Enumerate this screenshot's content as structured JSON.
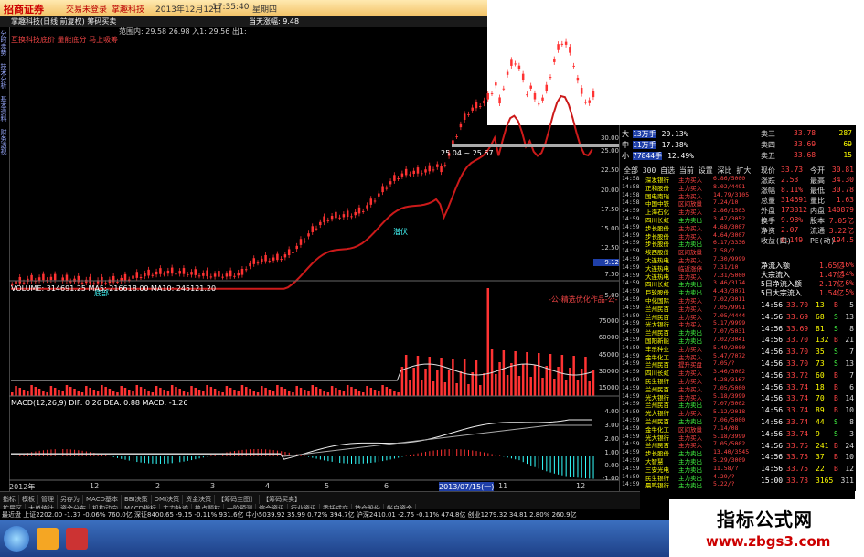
{
  "app": {
    "logo_text": "招商证券",
    "title_links": [
      "交易未登录",
      "掌趣科技",
      "2013年12月12日",
      "17:35:40",
      "星期四"
    ],
    "sub_title": "掌趣科技(日线 前复权)  筹码买卖",
    "indicator_line": "范围内: 29.58  26.98  入1: 29.56  出1:",
    "formula_line": "互换科技底价  量能底分  马上吸筹",
    "center_label": "当天涨幅: 9.48"
  },
  "left_tabs": [
    "分时走势",
    "技术分析",
    "基本资料",
    "财务透视"
  ],
  "price_axis": [
    "30.00",
    "25.00",
    "22.50",
    "20.00",
    "17.50",
    "15.00",
    "12.50",
    "10.00",
    "9.12",
    "7.50",
    "5.00"
  ],
  "volume_axis": [
    "75000",
    "60000",
    "45000",
    "30000",
    "15000"
  ],
  "macd_axis": [
    "4.00",
    "3.00",
    "2.00",
    "1.00",
    "0.00",
    "-1.00"
  ],
  "labels": {
    "volume": "VOLUME: 314691.25  MA5: 216618.00  MA10: 245121.20",
    "macd": "MACD(12,26,9)  DIF: 0.26  DEA: 0.88  MACD: -1.26",
    "box_label": "25.04 ~ 25.67",
    "bottom_label_1": "底部",
    "bottom_label_2": "潜伏",
    "footer_note": "-公-精选优化作品-公-",
    "date_axis": [
      "2012年",
      "12",
      "2",
      "3",
      "4",
      "5",
      "6",
      "2013/07/15(一)",
      "11",
      "12"
    ],
    "right_price_label": "日线"
  },
  "chip_legend": [
    {
      "side": "大",
      "amount": "13万手",
      "pct": "20.13%"
    },
    {
      "side": "中",
      "amount": "11万手",
      "pct": "17.38%"
    },
    {
      "side": "小",
      "amount": "77844手",
      "pct": "12.49%"
    }
  ],
  "top_sell_quote": [
    {
      "label": "卖三",
      "price": "33.78",
      "vol": "287"
    },
    {
      "label": "卖四",
      "price": "33.69",
      "vol": "69"
    },
    {
      "label": "卖五",
      "price": "33.68",
      "vol": "15"
    }
  ],
  "quote_tabs": "全部  300  自选  当前  设置  深比  扩大",
  "stats": [
    {
      "k": "现价",
      "v": "33.73",
      "k2": "今开",
      "v2": "30.81"
    },
    {
      "k": "涨跌",
      "v": "2.53",
      "k2": "最高",
      "v2": "34.30"
    },
    {
      "k": "涨幅",
      "v": "8.11%",
      "k2": "最低",
      "v2": "30.78"
    },
    {
      "k": "总量",
      "v": "314691",
      "k2": "量比",
      "v2": "1.63"
    },
    {
      "k": "外盘",
      "v": "173812",
      "k2": "内盘",
      "v2": "140879"
    },
    {
      "k": "换手",
      "v": "9.98%",
      "k2": "股本",
      "v2": "7.05亿"
    },
    {
      "k": "净资",
      "v": "2.07",
      "k2": "流通",
      "v2": "3.22亿"
    },
    {
      "k": "收益(四)",
      "v": "0.149",
      "k2": "PE(动)",
      "v2": "194.5"
    }
  ],
  "flows": [
    {
      "k": "净流入额",
      "v": "1.65亿",
      "p": "16%"
    },
    {
      "k": "大宗流入",
      "v": "1.47亿",
      "p": "14%"
    },
    {
      "k": "5日净流入额",
      "v": "2.17亿",
      "p": "6%"
    },
    {
      "k": "5日大宗流入",
      "v": "1.54亿",
      "p": "5%"
    }
  ],
  "ticks": [
    {
      "t": "14:56",
      "p": "33.70",
      "v": "13",
      "s": "B",
      "n": "5"
    },
    {
      "t": "14:56",
      "p": "33.69",
      "v": "68",
      "s": "S",
      "n": "13"
    },
    {
      "t": "14:56",
      "p": "33.69",
      "v": "81",
      "s": "S",
      "n": "8"
    },
    {
      "t": "14:56",
      "p": "33.70",
      "v": "132",
      "s": "B",
      "n": "21"
    },
    {
      "t": "14:56",
      "p": "33.70",
      "v": "35",
      "s": "S",
      "n": "7"
    },
    {
      "t": "14:56",
      "p": "33.70",
      "v": "73",
      "s": "S",
      "n": "13"
    },
    {
      "t": "14:56",
      "p": "33.72",
      "v": "60",
      "s": "B",
      "n": "7"
    },
    {
      "t": "14:56",
      "p": "33.74",
      "v": "18",
      "s": "B",
      "n": "6"
    },
    {
      "t": "14:56",
      "p": "33.74",
      "v": "70",
      "s": "B",
      "n": "14"
    },
    {
      "t": "14:56",
      "p": "33.74",
      "v": "89",
      "s": "B",
      "n": "10"
    },
    {
      "t": "14:56",
      "p": "33.74",
      "v": "44",
      "s": "S",
      "n": "8"
    },
    {
      "t": "14:56",
      "p": "33.74",
      "v": "9",
      "s": "S",
      "n": "3"
    },
    {
      "t": "14:56",
      "p": "33.75",
      "v": "241",
      "s": "B",
      "n": "24"
    },
    {
      "t": "14:56",
      "p": "33.75",
      "v": "37",
      "s": "B",
      "n": "10"
    },
    {
      "t": "14:56",
      "p": "33.75",
      "v": "22",
      "s": "B",
      "n": "12"
    },
    {
      "t": "15:00",
      "p": "33.73",
      "v": "3165",
      "s": "",
      "n": "311"
    }
  ],
  "monitor": [
    {
      "t": "14:58",
      "n": "深发银行",
      "a": "主力买入",
      "v": "6.86/5000"
    },
    {
      "t": "14:58",
      "n": "正和股份",
      "a": "主力买入",
      "v": "8.02/4491"
    },
    {
      "t": "14:58",
      "n": "国电南瑞",
      "a": "主力买入",
      "v": "14.79/3105"
    },
    {
      "t": "14:58",
      "n": "中国中铁",
      "a": "区间放量",
      "v": "7.24/10"
    },
    {
      "t": "14:59",
      "n": "上海石化",
      "a": "主力买入",
      "v": "2.86/1503"
    },
    {
      "t": "14:59",
      "n": "四川长虹",
      "a": "主力卖出",
      "v": "3.47/3052"
    },
    {
      "t": "14:59",
      "n": "步长股份",
      "a": "主力买入",
      "v": "4.68/3007"
    },
    {
      "t": "14:59",
      "n": "步长股份",
      "a": "主力买入",
      "v": "4.64/3007"
    },
    {
      "t": "14:59",
      "n": "步长股份",
      "a": "主力卖出",
      "v": "6.17/3336"
    },
    {
      "t": "14:59",
      "n": "埃西股份",
      "a": "区间放量",
      "v": "7.58/?"
    },
    {
      "t": "14:59",
      "n": "大连热电",
      "a": "主力买入",
      "v": "7.30/9999"
    },
    {
      "t": "14:59",
      "n": "大连热电",
      "a": "临近涨停",
      "v": "7.31/10"
    },
    {
      "t": "14:59",
      "n": "大连热电",
      "a": "主力买入",
      "v": "7.31/5000"
    },
    {
      "t": "14:59",
      "n": "四川长虹",
      "a": "主力卖出",
      "v": "3.46/3174"
    },
    {
      "t": "14:59",
      "n": "巨轮股份",
      "a": "主力卖出",
      "v": "4.43/3071"
    },
    {
      "t": "14:59",
      "n": "中化国际",
      "a": "主力买入",
      "v": "7.02/3011"
    },
    {
      "t": "14:59",
      "n": "兰州民百",
      "a": "主力买入",
      "v": "7.05/9991"
    },
    {
      "t": "14:59",
      "n": "兰州民百",
      "a": "主力买入",
      "v": "7.05/4444"
    },
    {
      "t": "14:59",
      "n": "光大银行",
      "a": "主力买入",
      "v": "5.17/9999"
    },
    {
      "t": "14:59",
      "n": "兰州民百",
      "a": "主力卖出",
      "v": "7.07/5031"
    },
    {
      "t": "14:59",
      "n": "国阳新能",
      "a": "主力卖出",
      "v": "7.02/3041"
    },
    {
      "t": "14:59",
      "n": "丰乐种业",
      "a": "主力买入",
      "v": "5.49/2000"
    },
    {
      "t": "14:59",
      "n": "金牛化工",
      "a": "主力买入",
      "v": "5.47/7072"
    },
    {
      "t": "14:59",
      "n": "兰州民百",
      "a": "提升买盘",
      "v": "7.05/?"
    },
    {
      "t": "14:59",
      "n": "四川长虹",
      "a": "主力买入",
      "v": "3.46/3002"
    },
    {
      "t": "14:59",
      "n": "民生银行",
      "a": "主力买入",
      "v": "4.28/3167"
    },
    {
      "t": "14:59",
      "n": "兰州民百",
      "a": "主力买入",
      "v": "7.05/5000"
    },
    {
      "t": "14:59",
      "n": "光大银行",
      "a": "主力买入",
      "v": "5.18/3999"
    },
    {
      "t": "14:59",
      "n": "兰州民百",
      "a": "主力卖出",
      "v": "7.07/5002"
    },
    {
      "t": "14:59",
      "n": "光大银行",
      "a": "主力买入",
      "v": "5.12/2018"
    },
    {
      "t": "14:59",
      "n": "兰州民百",
      "a": "主力卖出",
      "v": "7.06/5000"
    },
    {
      "t": "14:59",
      "n": "金牛化工",
      "a": "区间放量",
      "v": "7.14/08"
    },
    {
      "t": "14:59",
      "n": "光大银行",
      "a": "主力买入",
      "v": "5.18/3999"
    },
    {
      "t": "14:59",
      "n": "兰州民百",
      "a": "主力买入",
      "v": "7.05/5002"
    },
    {
      "t": "14:59",
      "n": "步长股份",
      "a": "主力卖出",
      "v": "13.40/3545"
    },
    {
      "t": "14:59",
      "n": "大智慧",
      "a": "主力卖出",
      "v": "5.29/3009"
    },
    {
      "t": "14:59",
      "n": "三安光电",
      "a": "主力卖出",
      "v": "11.58/?"
    },
    {
      "t": "14:59",
      "n": "民生银行",
      "a": "主力卖出",
      "v": "4.29/?"
    },
    {
      "t": "14:59",
      "n": "晨鸣银行",
      "a": "主力卖出",
      "v": "5.22/?"
    }
  ],
  "bottom_tabs": [
    "指标",
    "模板",
    "管理",
    "另存为",
    "MACD基本",
    "BBI决策",
    "DMI决策",
    "资金决策",
    "【筹码主图】",
    "【筹码买卖】"
  ],
  "bottom_tabs2": [
    "扩展区",
    "大单统计",
    "资金分布",
    "机构动向",
    "MACD指标",
    "主力轨迹",
    "热点题材",
    "一阶预测",
    "综合资讯",
    "行业资讯",
    "委托成交",
    "持仓股份",
    "帐户资金"
  ],
  "status_text": "最近盘 上证2202.00 -1.37 -0.06% 760.0亿  深证8400.65 -9.15 -0.11% 931.6亿  中小5039.92 35.99 0.72% 394.7亿  沪深2410.01 -2.75 -0.11% 474.8亿  创业1279.32 34.81 2.80% 260.9亿",
  "watermark": {
    "title": "指标公式网",
    "url": "www.zbgs3.com"
  },
  "colors": {
    "up": "#ff3333",
    "down": "#33ffff",
    "ma_line": "#cc1a1a",
    "box": "#aaaaaa",
    "bg": "#000000",
    "accent": "#f3c46a"
  }
}
